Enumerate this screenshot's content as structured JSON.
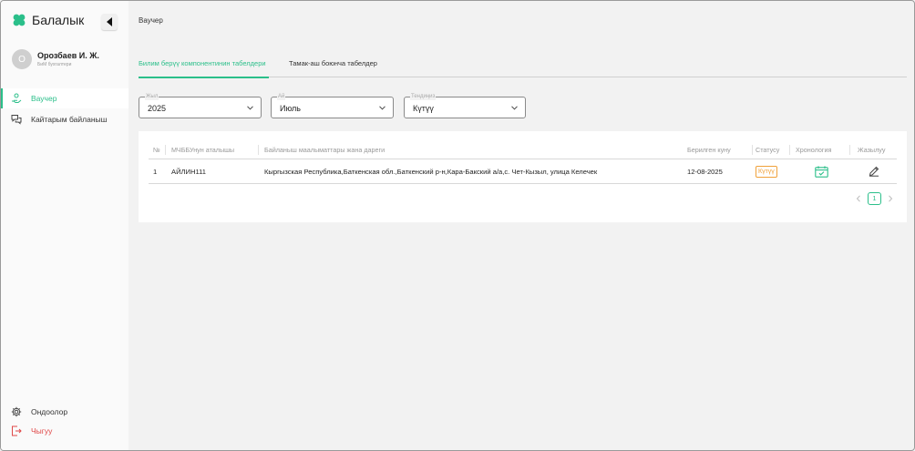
{
  "app": {
    "title": "Балалык"
  },
  "user": {
    "initial": "О",
    "name": "Орозбаев И. Ж.",
    "role": "БиМ бухгалтери"
  },
  "sidebar": {
    "items": [
      {
        "label": "Ваучер",
        "icon": "hand-money-icon",
        "active": true
      },
      {
        "label": "Кайтарым байланыш",
        "icon": "chat-bubbles-icon",
        "active": false
      }
    ],
    "bottom": [
      {
        "label": "Ондоолор",
        "icon": "gear-icon"
      },
      {
        "label": "Чыгуу",
        "icon": "logout-icon"
      }
    ]
  },
  "page": {
    "title": "Ваучер"
  },
  "tabs": [
    {
      "label": "Билим берүү компонентинин табелдери",
      "active": true
    },
    {
      "label": "Тамак-аш боюнча табелдер",
      "active": false
    }
  ],
  "filters": {
    "year": {
      "label": "Жыл",
      "value": "2025"
    },
    "month": {
      "label": "Ай",
      "value": "Июль"
    },
    "status": {
      "label": "Тендиңиз",
      "value": "Күтүү"
    }
  },
  "table": {
    "columns": [
      "№",
      "МЧББУнун аталышы",
      "Байланыш маалыматтары жана дареги",
      "Берилген куну",
      "Статусу",
      "Хронология",
      "Жазылуу"
    ],
    "rows": [
      {
        "num": "1",
        "name": "АЙЛИН111",
        "address": "Кыргызская Республика,Баткенская обл.,Баткенский р-н,Кара-Бакский а/а,с. Чет-Кызыл, улица Келечек",
        "date": "12-08-2025",
        "status": "Күтүү"
      }
    ]
  },
  "pagination": {
    "current": "1"
  },
  "colors": {
    "accent": "#2bbf8a",
    "warning": "#f0a13a",
    "danger": "#e04848"
  }
}
